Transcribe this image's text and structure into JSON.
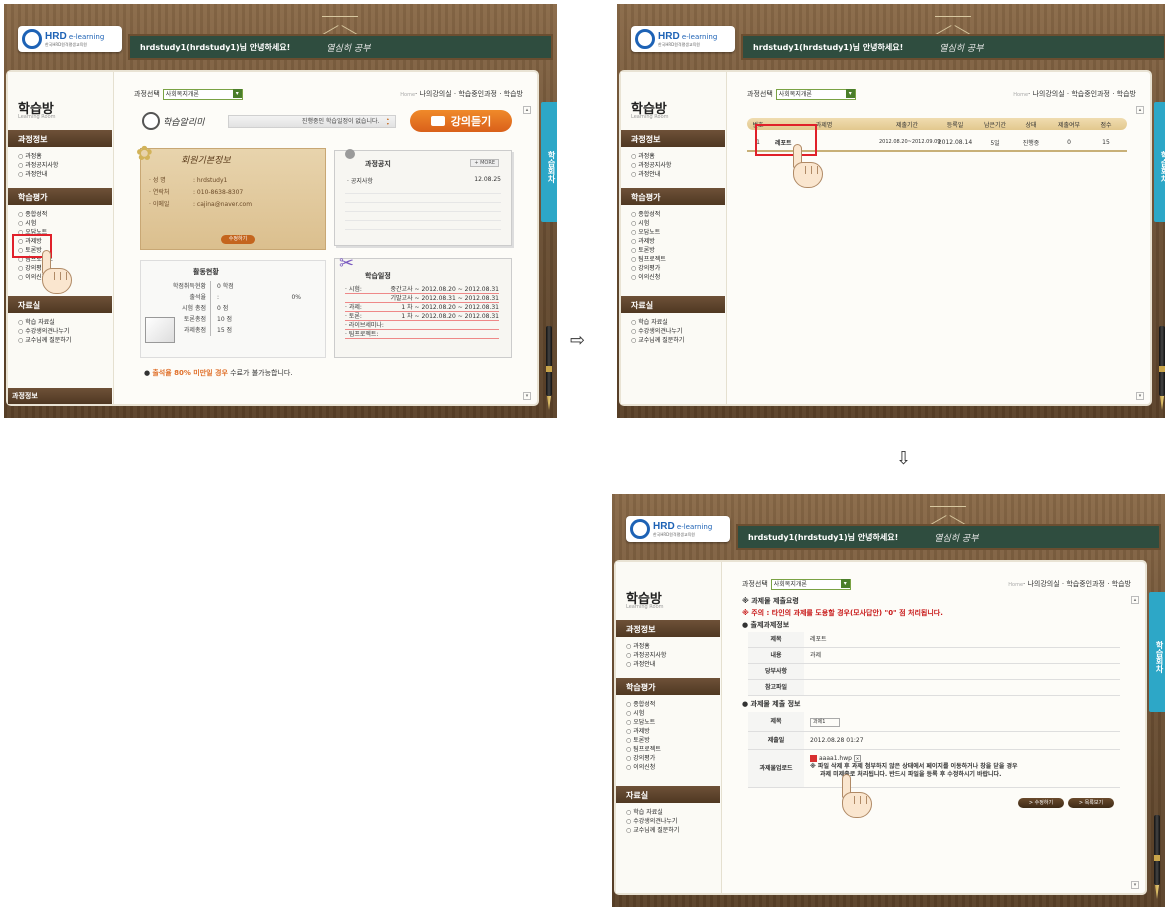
{
  "common": {
    "logo_brand": "HRD",
    "logo_text": "e-learning",
    "logo_sub": "한국HRD원격평생교육원",
    "greeting": "hrdstudy1(hrdstudy1)님 안녕하세요!",
    "chalk_text": "열심히 공부",
    "sidebar_title": "학습방",
    "sidebar_sub": "Learning Room",
    "sec_course": "과정정보",
    "course_items": [
      "과정홈",
      "과정공지사항",
      "과정안내"
    ],
    "sec_eval": "학습평가",
    "eval_items": [
      "종합성적",
      "시험",
      "오답노트",
      "과제방",
      "토론방",
      "팀프로젝트",
      "강의평가",
      "이의신청"
    ],
    "sec_data": "자료실",
    "data_items": [
      "학습 자료실",
      "수강생의견나누기",
      "교수님께 질문하기"
    ],
    "sidebar_bottom": "과정정보",
    "course_select_label": "과정선택",
    "course_select_value": "사회복지개론",
    "crumb_home": "Home",
    "crumb": "· 나의강의실 · 학습중인과정 · 학습방",
    "tab_label": "학습회차"
  },
  "screen1": {
    "alarm_title": "학습알리미",
    "alarm_msg": "진행중인 학습일정이 없습니다.",
    "lecture_button": "강의듣기",
    "member_title": "회원기본정보",
    "member_rows": [
      {
        "k": "· 성   명",
        "v": ": hrdstudy1"
      },
      {
        "k": "· 연락처",
        "v": ": 010-8638-8307"
      },
      {
        "k": "· 이메일",
        "v": ": cajina@naver.com"
      }
    ],
    "member_button": "수정하기",
    "notice_title": "과정공지",
    "notice_more": "+ MORE",
    "notice_item": "· 공지사항",
    "notice_date": "12.08.25",
    "activity_title": "활동현황",
    "activity_rows": [
      {
        "k": "학점취득현황",
        "v": "0 학점"
      },
      {
        "k": "출석율",
        "v": ":",
        "v2": "0%"
      },
      {
        "k": "시험 총점",
        "v": "0 점"
      },
      {
        "k": "토론총점",
        "v": "10 점"
      },
      {
        "k": "과제총점",
        "v": "15 점"
      }
    ],
    "schedule_title": "학습일정",
    "schedule_rows": [
      {
        "k": "· 시험:",
        "v": "중간고사 ~ 2012.08.20 ~ 2012.08.31"
      },
      {
        "k": "",
        "v": "기말고사 ~ 2012.08.31 ~ 2012.08.31"
      },
      {
        "k": "· 과제:",
        "v": "1 차 ~ 2012.08.20 ~ 2012.08.31"
      },
      {
        "k": "· 토론:",
        "v": "1 차 ~ 2012.08.20 ~ 2012.08.31"
      },
      {
        "k": "· 라이브세미나:",
        "v": ""
      },
      {
        "k": "· 팀프로젝트:",
        "v": ""
      }
    ],
    "warn_prefix": "출석율 80% 미만일 경우",
    "warn_suffix": " 수료가 불가능합니다."
  },
  "screen2": {
    "headers": [
      "번호",
      "과제명",
      "제출기간",
      "등록일",
      "남은기간",
      "상태",
      "제출여부",
      "점수"
    ],
    "row": [
      "1",
      "레포트",
      "2012.08.20~2012.09.09",
      "2012.08.14",
      "5일",
      "진행중",
      "0",
      "15"
    ]
  },
  "screen3": {
    "submit_header": "※ 과제물 제출요령",
    "submit_warning": "※ 주의 : 타인의 과제를 도용할 경우(모사답안) \"0\" 점 처리됩니다.",
    "task_info_header": "출제과제정보",
    "task_info": [
      {
        "k": "제목",
        "v": "레포트"
      },
      {
        "k": "내용",
        "v": "과제"
      },
      {
        "k": "당부사항",
        "v": ""
      },
      {
        "k": "참고파일",
        "v": ""
      }
    ],
    "submit_info_header": "과제물 제출 정보",
    "submit_title_k": "제목",
    "submit_title_v": "과제1",
    "submit_date_k": "제출일",
    "submit_date_v": "2012.08.28 01:27",
    "upload_k": "과제물업로드",
    "upload_file": "aaaa1.hwp",
    "upload_note_1": "※ 파일 삭제 후 과제 첨부하지 않은 상태에서 페이지를 이동하거나 창을 닫을 경우",
    "upload_note_2": "과제 미제출로 처리됩니다. 반드시 파일을 등록 후 수정하시기 바랍니다.",
    "edit_button": "> 수정하기",
    "list_button": "> 목록보기"
  },
  "arrows": {
    "right": "⇨",
    "down": "⇩"
  }
}
